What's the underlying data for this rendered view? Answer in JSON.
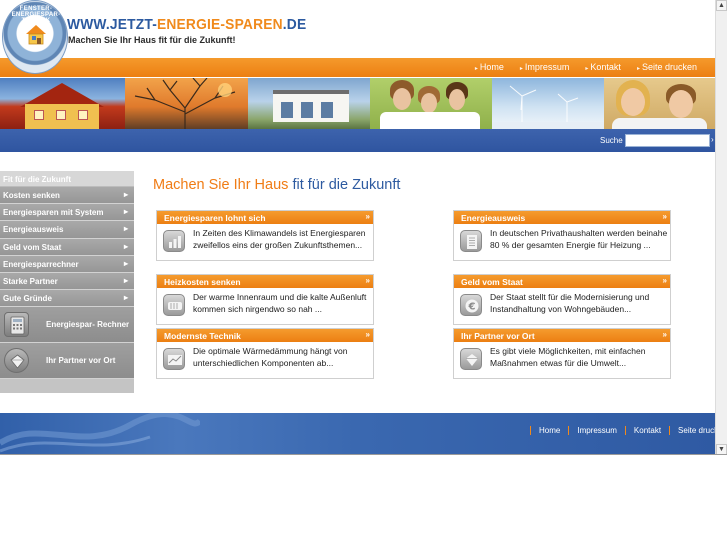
{
  "header": {
    "logo_text": "FENSTER-ENERGIESPAR-TECHNIK",
    "url_part1": "WWW.JETZT-",
    "url_part2": "ENERGIE-SPAREN",
    "url_part3": ".DE",
    "tagline": "Machen Sie Ihr Haus fit für die Zukunft!"
  },
  "topnav": {
    "items": [
      "Home",
      "Impressum",
      "Kontakt",
      "Seite drucken"
    ]
  },
  "search": {
    "label": "Suche",
    "value": ""
  },
  "sidebar": {
    "heading": "Fit für die Zukunft",
    "items": [
      {
        "label": "Kosten senken"
      },
      {
        "label": "Energiesparen mit System"
      },
      {
        "label": "Energieausweis"
      },
      {
        "label": "Geld vom Staat"
      },
      {
        "label": "Energiesparrechner"
      },
      {
        "label": "Starke Partner"
      },
      {
        "label": "Gute Gründe"
      }
    ],
    "tools": [
      {
        "label": "Energiespar- Rechner",
        "icon": "calculator-icon"
      },
      {
        "label": "Ihr Partner vor Ort",
        "icon": "diamond-icon"
      }
    ]
  },
  "main": {
    "title_part1": "Machen Sie Ihr Haus ",
    "title_part2": "fit für die Zukunft",
    "boxes": [
      {
        "title": "Energiesparen lohnt sich",
        "text": "In Zeiten des Klimawandels ist Energiesparen zweifellos eins der großen Zukunftsthemen...",
        "icon": "bar-chart-icon"
      },
      {
        "title": "Energieausweis",
        "text": "In deutschen Privathaushalten werden beinahe 80 % der gesamten Energie für Heizung ...",
        "icon": "document-icon"
      },
      {
        "title": "Heizkosten senken",
        "text": "Der warme Innenraum und die kalte Außenluft kommen sich nirgendwo so nah ...",
        "icon": "radiator-icon"
      },
      {
        "title": "Geld vom Staat",
        "text": "Der Staat stellt für die Modernisierung und Instandhaltung von Wohngebäuden...",
        "icon": "euro-icon"
      },
      {
        "title": "Modernste Technik",
        "text": "Die optimale Wärmedämmung hängt von unterschiedlichen Komponenten ab...",
        "icon": "line-chart-icon"
      },
      {
        "title": "Ihr Partner vor Ort",
        "text": "Es gibt viele Möglichkeiten, mit einfachen Maßnahmen etwas für die Umwelt...",
        "icon": "diamond-icon"
      }
    ]
  },
  "footer": {
    "items": [
      "Home",
      "Impressum",
      "Kontakt",
      "Seite drucken"
    ]
  },
  "colors": {
    "orange": "#f08a1c",
    "blue": "#2f55a0",
    "sidebar_gray": "#a0a0a0"
  }
}
